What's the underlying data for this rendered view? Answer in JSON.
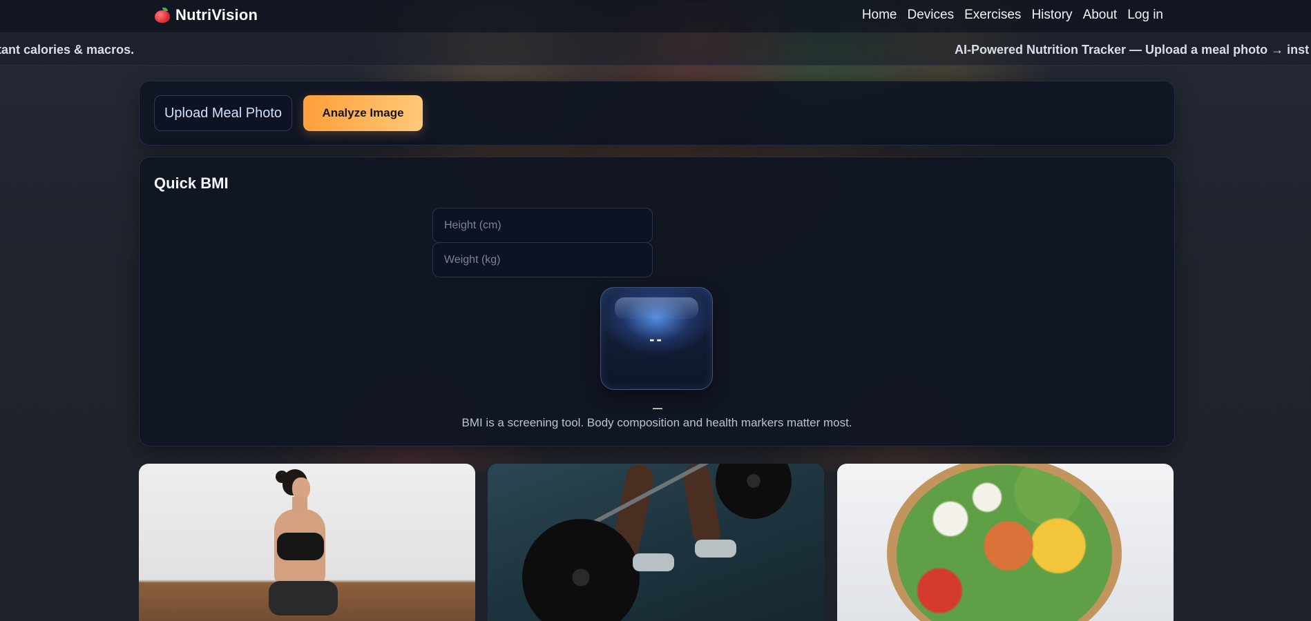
{
  "app": {
    "brand": "NutriVision",
    "brand_icon": "apple-icon"
  },
  "nav": {
    "links": [
      "Home",
      "Devices",
      "Exercises",
      "History",
      "About",
      "Log in"
    ]
  },
  "ticker": {
    "segment_left": "tant calories & macros.",
    "segment_right": "AI-Powered Nutrition Tracker — Upload a meal photo → inst"
  },
  "upload": {
    "upload_label": "Upload Meal Photo",
    "analyze_label": "Analyze Image"
  },
  "bmi": {
    "title": "Quick BMI",
    "height_placeholder": "Height (cm)",
    "weight_placeholder": "Weight (kg)",
    "value": "--",
    "category": "—",
    "note": "BMI is a screening tool. Body composition and health markers matter most."
  },
  "tiles": [
    "yoga-photo",
    "weightlifting-photo",
    "salad-bowl-photo"
  ],
  "colors": {
    "accent_orange_start": "#ff9f3a",
    "accent_orange_end": "#ffc978",
    "card_bg": "#101523",
    "page_bg": "#1f232c"
  }
}
